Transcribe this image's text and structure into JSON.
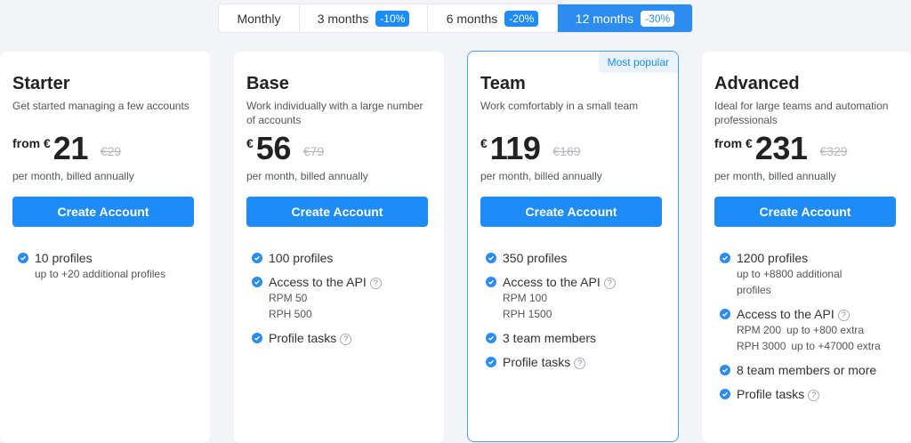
{
  "periods": [
    {
      "label": "Monthly",
      "discount": ""
    },
    {
      "label": "3 months",
      "discount": "-10%"
    },
    {
      "label": "6 months",
      "discount": "-20%"
    },
    {
      "label": "12 months",
      "discount": "-30%",
      "active": true
    }
  ],
  "colors": {
    "accent": "#1d8cf8",
    "card": "#ffffff",
    "background": "#f2f4f7"
  },
  "plans": [
    {
      "name": "Starter",
      "description": "Get started managing a few accounts",
      "price_prefix": "from €",
      "price": "21",
      "old_price": "€29",
      "billing": "per month, billed annually",
      "cta": "Create Account",
      "features": {
        "profiles": "10 profiles",
        "profiles_sub": "up to +20 additional profiles"
      }
    },
    {
      "name": "Base",
      "description": "Work individually with a large number of accounts",
      "price_prefix": "€",
      "price": "56",
      "old_price": "€79",
      "billing": "per month, billed annually",
      "cta": "Create Account",
      "features": {
        "profiles": "100 profiles",
        "api": "Access to the API",
        "rpm": "RPM 50",
        "rph": "RPH 500",
        "tasks": "Profile tasks"
      }
    },
    {
      "name": "Team",
      "badge": "Most popular",
      "description": "Work comfortably in a small team",
      "price_prefix": "€",
      "price": "119",
      "old_price": "€169",
      "billing": "per month, billed annually",
      "cta": "Create Account",
      "features": {
        "profiles": "350 profiles",
        "api": "Access to the API",
        "rpm": "RPM 100",
        "rph": "RPH 1500",
        "members": "3 team members",
        "tasks": "Profile tasks"
      }
    },
    {
      "name": "Advanced",
      "description": "Ideal for large teams and automation professionals",
      "price_prefix": "from €",
      "price": "231",
      "old_price": "€329",
      "billing": "per month, billed annually",
      "cta": "Create Account",
      "features": {
        "profiles": "1200 profiles",
        "profiles_sub": "up to +8800 additional profiles",
        "api": "Access to the API",
        "rpm": "RPM 200",
        "rpm_extra": "up to +800 extra",
        "rph": "RPH 3000",
        "rph_extra": "up to +47000 extra",
        "members": "8 team members or more",
        "tasks": "Profile tasks"
      }
    }
  ]
}
